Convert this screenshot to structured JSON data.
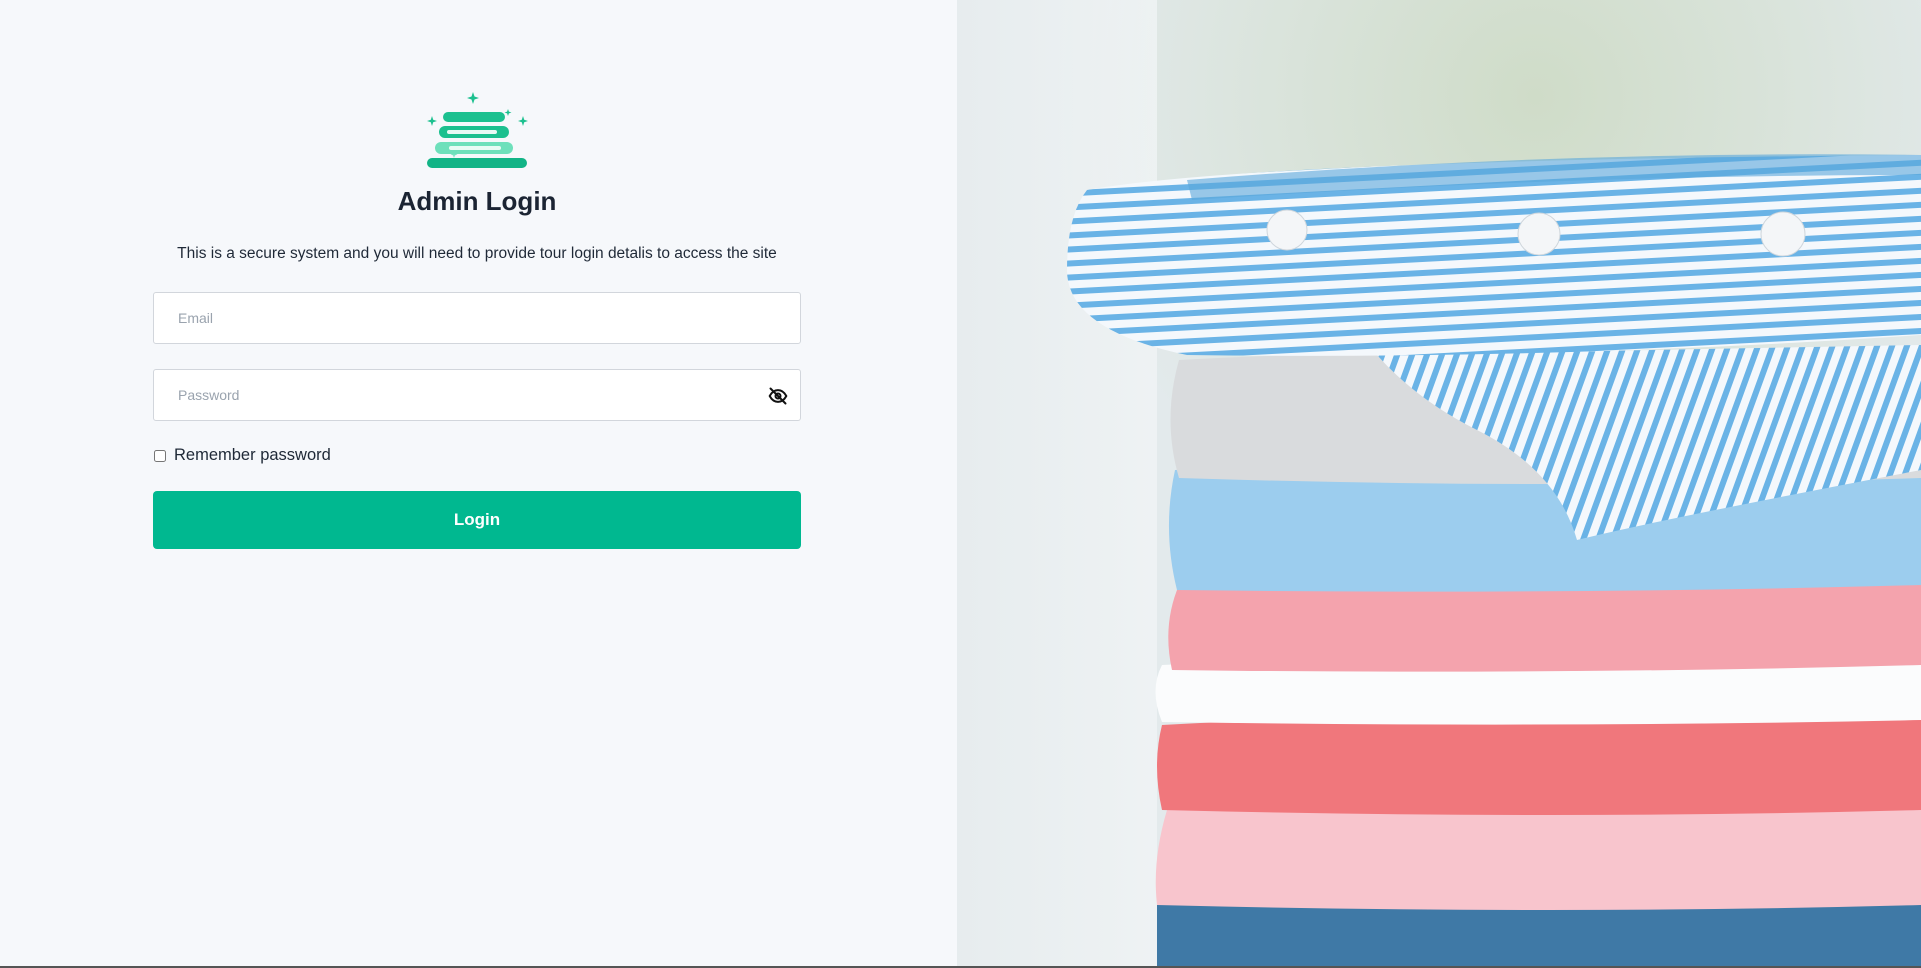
{
  "login": {
    "title": "Admin Login",
    "subtitle": "This is a secure system and you will need to provide tour login detalis to access the site",
    "email_placeholder": "Email",
    "password_placeholder": "Password",
    "password_toggle_icon": "eye-off-icon",
    "remember_label": "Remember password",
    "remember_checked": false,
    "login_button_label": "Login"
  },
  "logo": {
    "icon": "folded-laundry-sparkle-icon",
    "color": "#1cc08f"
  },
  "hero_image": {
    "subject": "stacked folded clothes photo"
  },
  "colors": {
    "accent": "#00b890",
    "left_background": "#f6f8fb"
  }
}
